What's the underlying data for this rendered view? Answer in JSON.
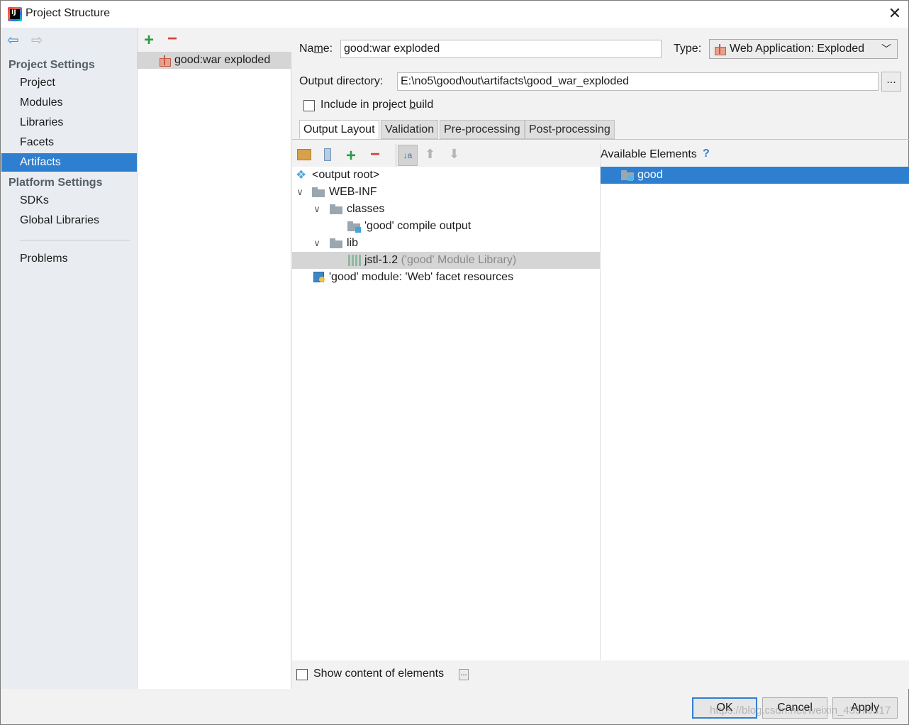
{
  "window": {
    "title": "Project Structure"
  },
  "nav": {
    "project_settings_header": "Project Settings",
    "project_items": [
      "Project",
      "Modules",
      "Libraries",
      "Facets",
      "Artifacts"
    ],
    "selected": "Artifacts",
    "platform_settings_header": "Platform Settings",
    "platform_items": [
      "SDKs",
      "Global Libraries"
    ],
    "problems": "Problems"
  },
  "artifacts_list": {
    "items": [
      "good:war exploded"
    ]
  },
  "form": {
    "name_label_pre": "Na",
    "name_label_u": "m",
    "name_label_post": "e:",
    "name_value": "good:war exploded",
    "type_label": "Type:",
    "type_value": "Web Application: Exploded",
    "output_dir_label": "Output directory:",
    "output_dir_value": "E:\\no5\\good\\out\\artifacts\\good_war_exploded",
    "browse_label": "...",
    "include_pre": "Include in project ",
    "include_u": "b",
    "include_post": "uild",
    "include_checked": false
  },
  "tabs": [
    "Output Layout",
    "Validation",
    "Pre-processing",
    "Post-processing"
  ],
  "active_tab": "Output Layout",
  "output_tree": {
    "root": "<output root>",
    "web_inf": "WEB-INF",
    "classes": "classes",
    "compile_output": "'good' compile output",
    "lib": "lib",
    "jstl_name": "jstl-1.2",
    "jstl_detail": "('good' Module Library)",
    "facet_resources": "'good' module: 'Web' facet resources"
  },
  "available": {
    "title": "Available Elements",
    "help": "?",
    "items": [
      "good"
    ]
  },
  "bottom": {
    "show_content_label": "Show content of elements",
    "show_content_checked": false,
    "more": "..."
  },
  "buttons": {
    "ok": "OK",
    "cancel": "Cancel",
    "apply": "Apply"
  },
  "watermark": "https://blog.csdn.net/weixin_43570317",
  "colors": {
    "selection": "#2f7fd0",
    "nav_bg": "#e9edf1",
    "add": "#2e9a45",
    "remove": "#d6413b"
  }
}
